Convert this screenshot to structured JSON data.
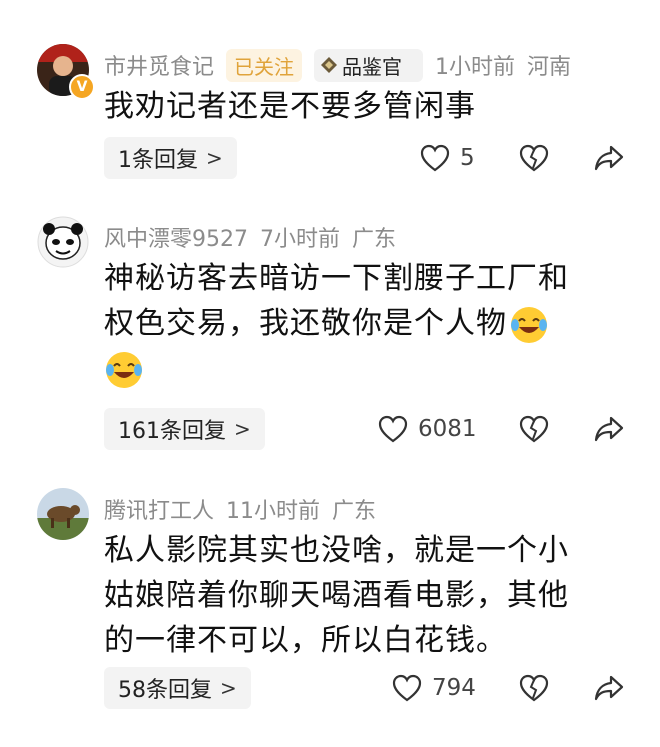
{
  "comments": [
    {
      "username": "市井觅食记",
      "followed": "已关注",
      "badge": "品鉴官",
      "time": "1小时前",
      "location": "河南",
      "text": "我劝记者还是不要多管闲事",
      "replies": "1条回复",
      "likes": "5"
    },
    {
      "username": "风中漂零9527",
      "time": "7小时前",
      "location": "广东",
      "text_line1": "神秘访客去暗访一下割腰子工厂和",
      "text_line2": "权色交易，我还敬你是个人物",
      "replies": "161条回复",
      "likes": "6081"
    },
    {
      "username": "腾讯打工人",
      "time": "11小时前",
      "location": "广东",
      "text_line1": "私人影院其实也没啥，就是一个小",
      "text_line2": "姑娘陪着你聊天喝酒看电影，其他",
      "text_line3": "的一律不可以，所以白花钱。",
      "replies": "58条回复",
      "likes": "794"
    }
  ],
  "icons": {
    "like": "heart-outline-icon",
    "dislike": "broken-heart-icon",
    "share": "share-arrow-icon",
    "reply_chevron": "chevron-right-icon",
    "emoji": "laughing-tears-emoji",
    "verified": "verified-v-icon",
    "badge": "diamond-badge-icon"
  },
  "colors": {
    "meta_gray": "#8b8b8b",
    "followed_text": "#e0a33a",
    "followed_bg": "#fdf3e1",
    "reply_bg": "#f3f3f3",
    "verified": "#f5a623"
  }
}
